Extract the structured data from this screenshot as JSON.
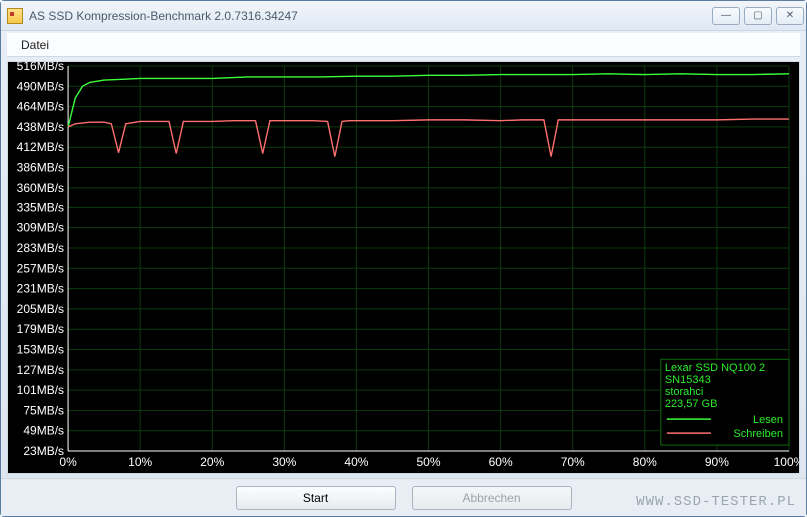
{
  "window": {
    "title": "AS SSD Kompression-Benchmark 2.0.7316.34247"
  },
  "menu": {
    "file": "Datei"
  },
  "buttons": {
    "start": "Start",
    "cancel": "Abbrechen"
  },
  "watermark": "WWW.SSD-TESTER.PL",
  "legend": {
    "device": "Lexar SSD NQ100 2",
    "serial": "SN15343",
    "driver": "storahci",
    "capacity": "223,57 GB",
    "read": "Lesen",
    "write": "Schreiben"
  },
  "chart_data": {
    "type": "line",
    "title": "",
    "xlabel": "",
    "ylabel": "",
    "xlim": [
      0,
      100
    ],
    "ylim": [
      23,
      516
    ],
    "y_ticks": [
      516,
      490,
      464,
      438,
      412,
      386,
      360,
      335,
      309,
      283,
      257,
      231,
      205,
      179,
      153,
      127,
      101,
      75,
      49,
      23
    ],
    "y_tick_labels": [
      "516MB/s",
      "490MB/s",
      "464MB/s",
      "438MB/s",
      "412MB/s",
      "386MB/s",
      "360MB/s",
      "335MB/s",
      "309MB/s",
      "283MB/s",
      "257MB/s",
      "231MB/s",
      "205MB/s",
      "179MB/s",
      "153MB/s",
      "127MB/s",
      "101MB/s",
      "75MB/s",
      "49MB/s",
      "23MB/s"
    ],
    "x_ticks": [
      0,
      10,
      20,
      30,
      40,
      50,
      60,
      70,
      80,
      90,
      100
    ],
    "x_tick_labels": [
      "0%",
      "10%",
      "20%",
      "30%",
      "40%",
      "50%",
      "60%",
      "70%",
      "80%",
      "90%",
      "100%"
    ],
    "series": [
      {
        "name": "Lesen",
        "color": "#3bff3b",
        "x": [
          0,
          1,
          2,
          3,
          5,
          10,
          15,
          20,
          25,
          30,
          35,
          40,
          45,
          50,
          55,
          60,
          65,
          70,
          75,
          80,
          85,
          90,
          95,
          100
        ],
        "y": [
          438,
          475,
          490,
          495,
          498,
          500,
          500,
          500,
          502,
          502,
          502,
          503,
          503,
          504,
          504,
          505,
          505,
          505,
          506,
          505,
          506,
          505,
          505,
          506
        ]
      },
      {
        "name": "Schreiben",
        "color": "#ff6f6f",
        "x": [
          0,
          1,
          3,
          5,
          6,
          7,
          8,
          10,
          13,
          14,
          15,
          16,
          17,
          20,
          23,
          25,
          26,
          27,
          28,
          30,
          33,
          34,
          36,
          37,
          38,
          39,
          40,
          45,
          50,
          55,
          60,
          63,
          65,
          66,
          67,
          68,
          70,
          75,
          80,
          85,
          90,
          95,
          100
        ],
        "y": [
          438,
          442,
          444,
          444,
          442,
          405,
          442,
          445,
          445,
          445,
          404,
          445,
          445,
          445,
          446,
          446,
          446,
          404,
          446,
          446,
          446,
          446,
          445,
          400,
          445,
          446,
          446,
          446,
          447,
          447,
          446,
          447,
          447,
          447,
          400,
          447,
          447,
          447,
          447,
          447,
          447,
          448,
          448
        ]
      }
    ]
  }
}
